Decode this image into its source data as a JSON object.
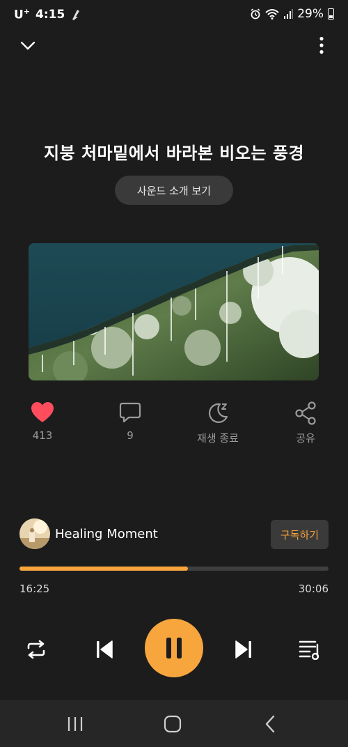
{
  "status_bar": {
    "carrier": "U",
    "carrier_sup": "+",
    "time": "4:15",
    "battery": "29%"
  },
  "track": {
    "title": "지붕 처마밑에서 바라본 비오는 풍경",
    "intro_button": "사운드 소개 보기"
  },
  "actions": {
    "like_count": "413",
    "comment_count": "9",
    "sleep_label": "재생 종료",
    "share_label": "공유"
  },
  "channel": {
    "name": "Healing Moment",
    "subscribe_label": "구독하기"
  },
  "player": {
    "elapsed": "16:25",
    "duration": "30:06",
    "progress_fraction": 0.546,
    "state": "playing"
  },
  "icons": {
    "collapse": "chevron-down-icon",
    "more": "more-vertical-icon",
    "like": "heart-icon",
    "comment": "comment-icon",
    "sleep": "moon-icon",
    "share": "share-icon",
    "repeat": "repeat-icon",
    "previous": "skip-previous-icon",
    "pause": "pause-icon",
    "next": "skip-next-icon",
    "queue": "playlist-icon"
  },
  "colors": {
    "accent": "#f7a53d",
    "like": "#ff4d5e",
    "background": "#1c1c1c"
  }
}
